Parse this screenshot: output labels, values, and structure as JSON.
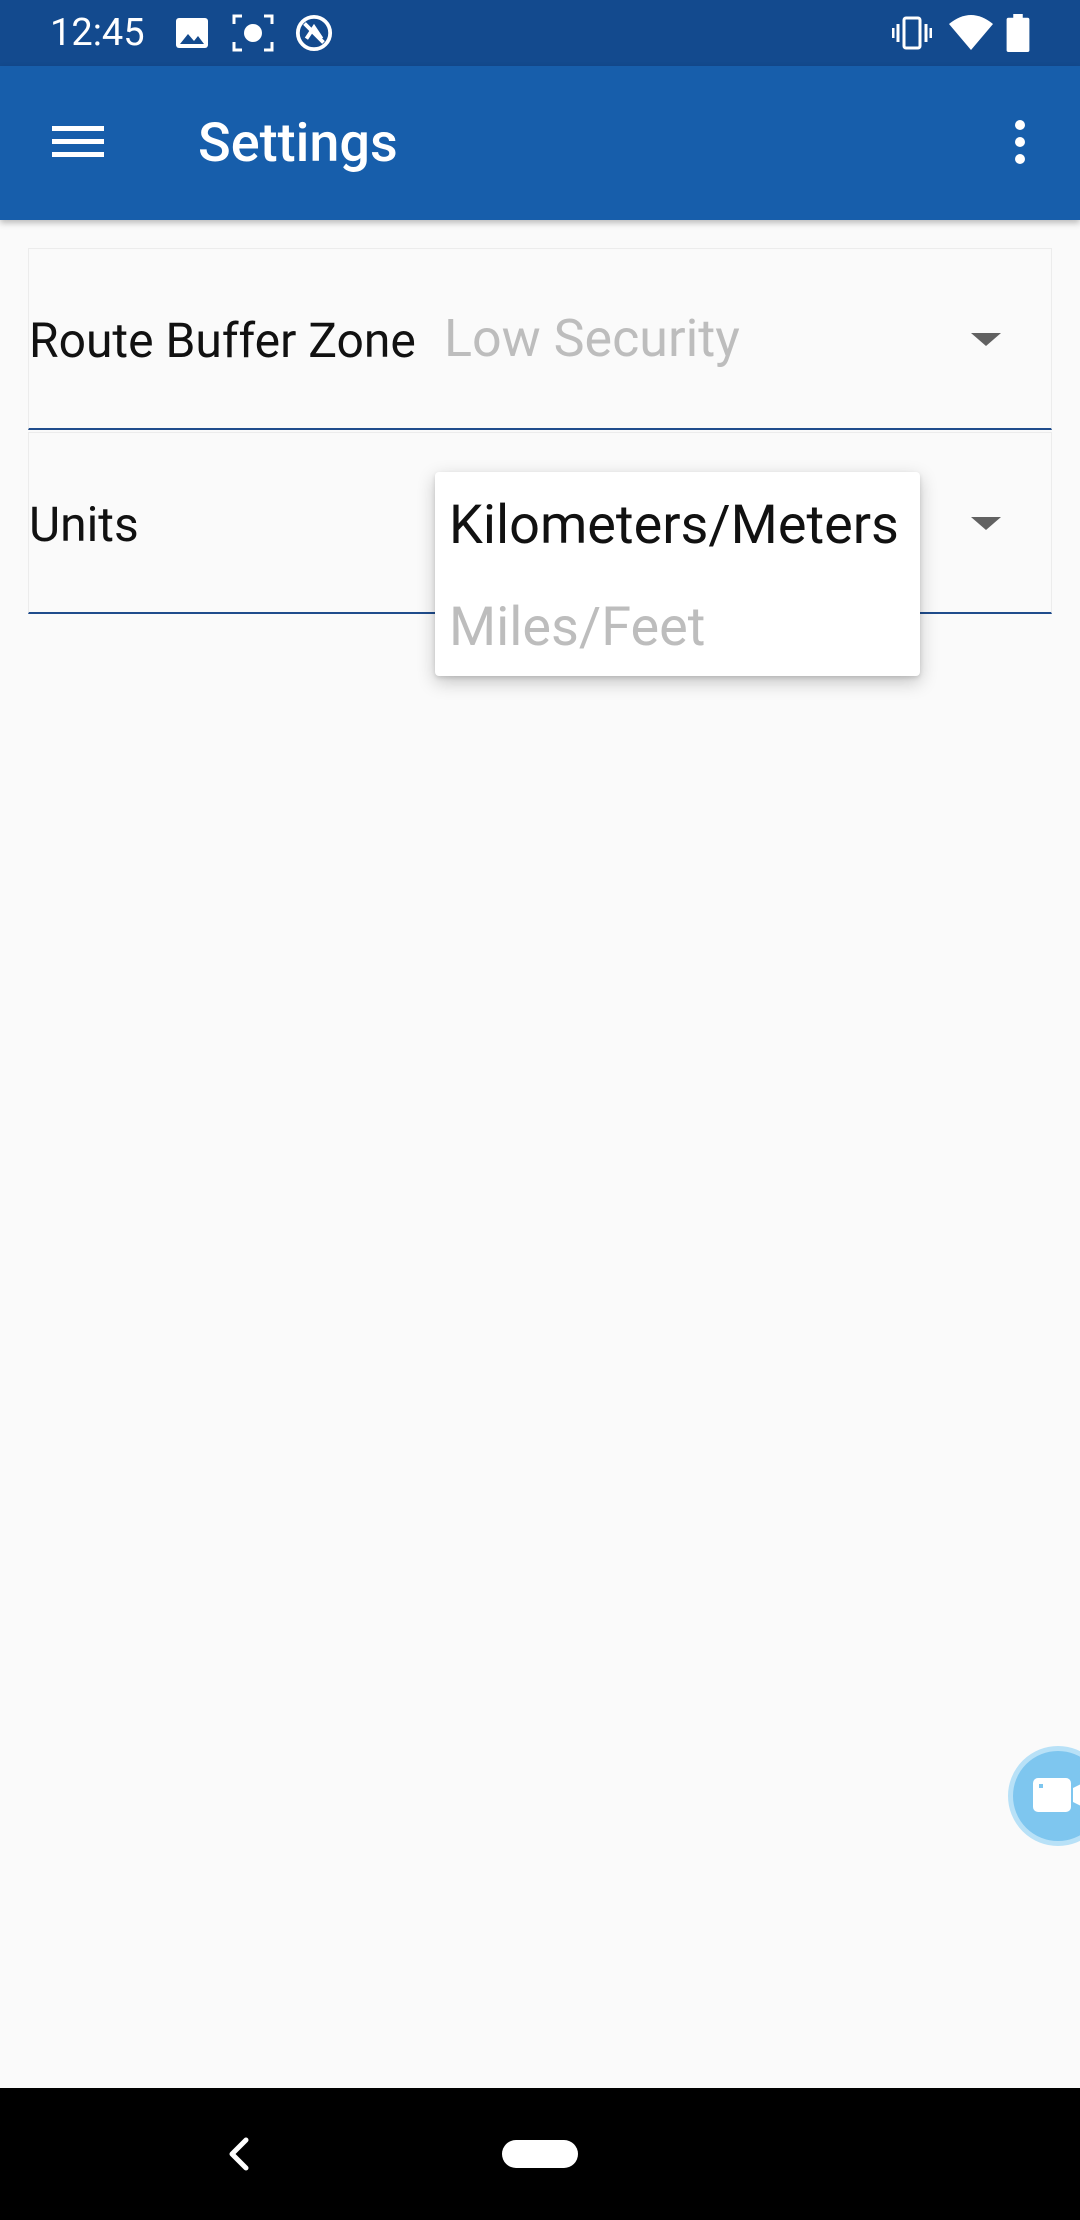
{
  "status_bar": {
    "time": "12:45",
    "left_icons": [
      "image-icon",
      "screenshot-icon",
      "vpn-icon"
    ],
    "right_icons": [
      "vibrate-icon",
      "wifi-icon",
      "battery-icon"
    ]
  },
  "app_bar": {
    "title": "Settings",
    "menu_icon": "hamburger-menu-icon",
    "overflow_icon": "more-vert-icon",
    "background": "#175eab"
  },
  "settings": {
    "route_buffer_zone": {
      "label": "Route Buffer Zone",
      "value": "Low Security"
    },
    "units": {
      "label": "Units"
    }
  },
  "units_dropdown": {
    "options": [
      {
        "label": "Kilometers/Meters",
        "selected": true
      },
      {
        "label": "Miles/Feet",
        "selected": false
      }
    ]
  },
  "fab": {
    "icon": "video-camera-icon",
    "color": "#7ec6ef"
  },
  "nav_bar": {
    "back_icon": "back-chevron-icon",
    "home_icon": "home-pill-icon"
  },
  "colors": {
    "status_bar": "#134a8e",
    "app_bar": "#175eab",
    "underline": "#1f4c8c",
    "muted_text": "#bdbdbd",
    "background": "#fafafa"
  }
}
